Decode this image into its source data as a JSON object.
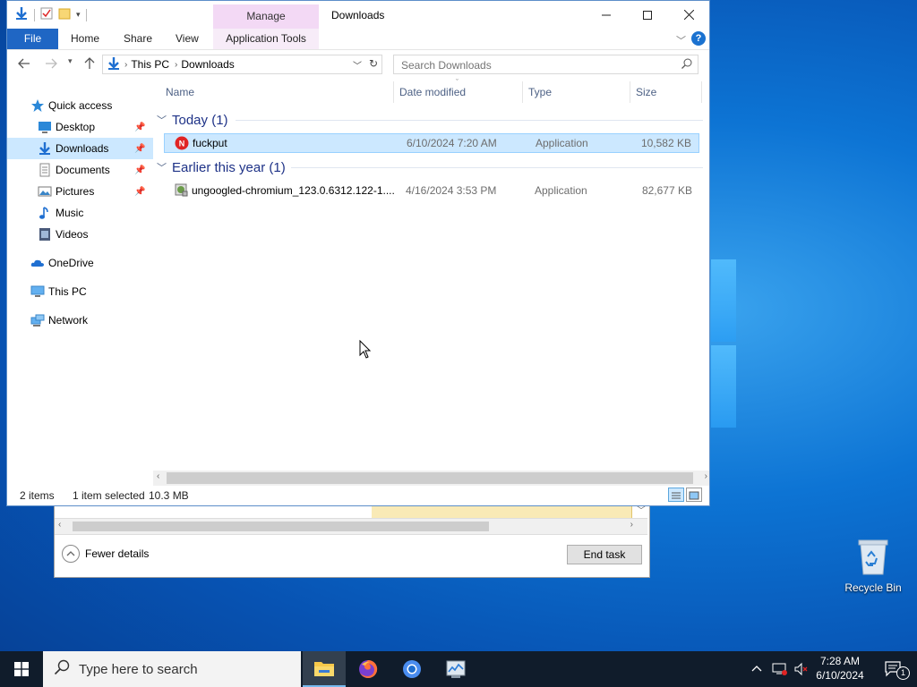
{
  "explorer": {
    "title": "Downloads",
    "manage_tab": "Manage",
    "ribbon_tabs": {
      "file": "File",
      "home": "Home",
      "share": "Share",
      "view": "View",
      "app_tools": "Application Tools"
    },
    "breadcrumb": [
      "This PC",
      "Downloads"
    ],
    "search_placeholder": "Search Downloads",
    "nav": {
      "quick_access": "Quick access",
      "desktop": "Desktop",
      "downloads": "Downloads",
      "documents": "Documents",
      "pictures": "Pictures",
      "music": "Music",
      "videos": "Videos",
      "onedrive": "OneDrive",
      "this_pc": "This PC",
      "network": "Network"
    },
    "columns": {
      "name": "Name",
      "date": "Date modified",
      "type": "Type",
      "size": "Size"
    },
    "groups": [
      {
        "label": "Today (1)",
        "files": [
          {
            "name": "fuckput",
            "date": "6/10/2024 7:20 AM",
            "type": "Application",
            "size": "10,582 KB"
          }
        ]
      },
      {
        "label": "Earlier this year (1)",
        "files": [
          {
            "name": "ungoogled-chromium_123.0.6312.122-1....",
            "date": "4/16/2024 3:53 PM",
            "type": "Application",
            "size": "82,677 KB"
          }
        ]
      }
    ],
    "status": {
      "items": "2 items",
      "selected": "1 item selected",
      "size": "10.3 MB"
    }
  },
  "taskmgr": {
    "fewer_details": "Fewer details",
    "end_task": "End task"
  },
  "desktop": {
    "recycle_bin": "Recycle Bin"
  },
  "taskbar": {
    "search_placeholder": "Type here to search",
    "time": "7:28 AM",
    "date": "6/10/2024",
    "notifications": "1"
  },
  "colors": {
    "accent": "#1f66c4",
    "selection": "#cce8ff",
    "manage_tab": "#f3d9f5",
    "taskbar": "#101c2b"
  }
}
